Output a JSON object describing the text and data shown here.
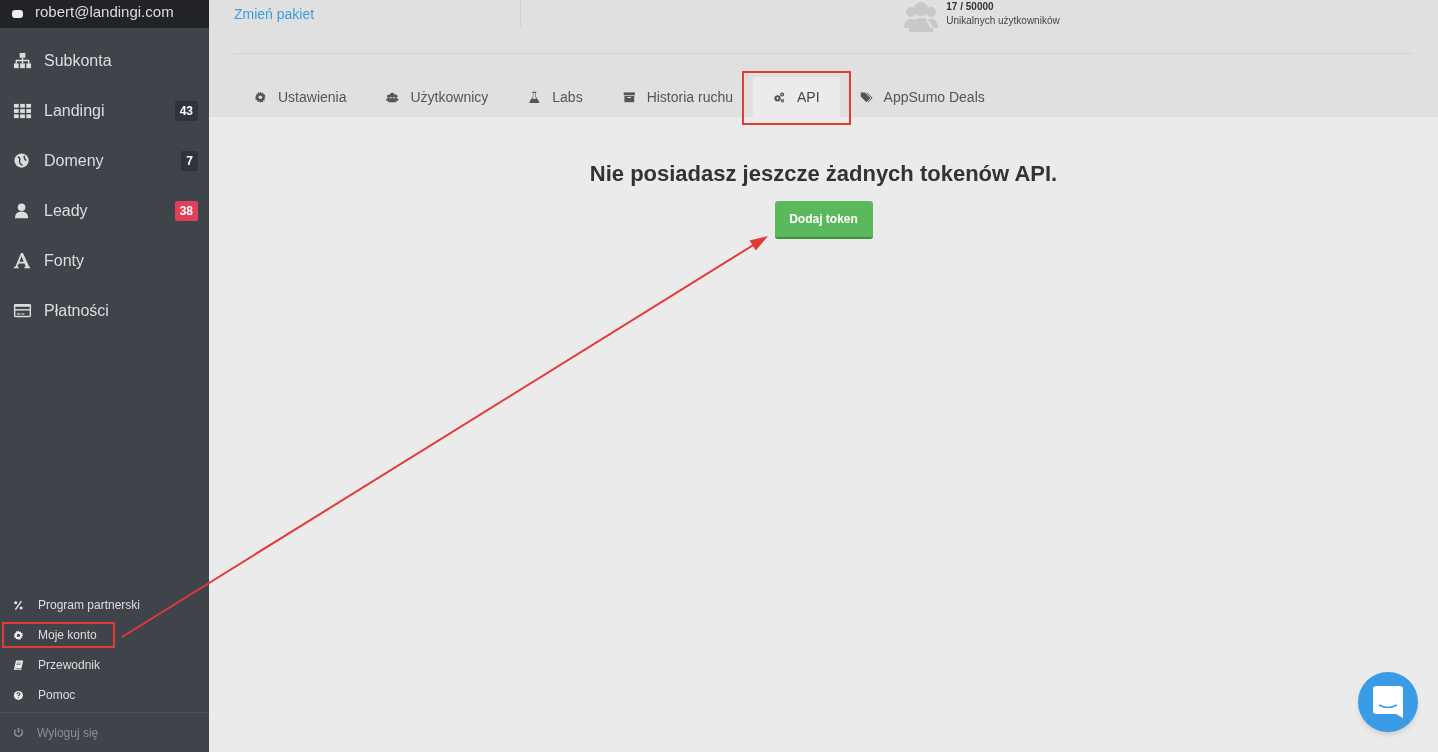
{
  "sidebar": {
    "account_email": "robert@landingi.com",
    "items": [
      {
        "label": "Subkonta"
      },
      {
        "label": "Landingi",
        "badge": "43",
        "color": "#30343a"
      },
      {
        "label": "Domeny",
        "badge": "7",
        "color": "#30343a"
      },
      {
        "label": "Leady",
        "badge": "38",
        "color": "#e0405a"
      },
      {
        "label": "Fonty"
      },
      {
        "label": "Płatności"
      }
    ],
    "footer_items": [
      {
        "label": "Program partnerski",
        "highlighted": false
      },
      {
        "label": "Moje konto",
        "highlighted": true
      },
      {
        "label": "Przewodnik",
        "highlighted": false
      },
      {
        "label": "Pomoc",
        "highlighted": false
      }
    ],
    "logout": {
      "label": "Wyloguj się"
    }
  },
  "header": {
    "change_plan_link": "Zmień pakiet",
    "users_count": "17 / 50000",
    "users_caption": "Unikalnych użytkowników"
  },
  "tabs": [
    {
      "label": "Ustawienia",
      "selected": false,
      "highlighted": false
    },
    {
      "label": "Użytkownicy",
      "selected": false,
      "highlighted": false
    },
    {
      "label": "Labs",
      "selected": false,
      "highlighted": false
    },
    {
      "label": "Historia ruchu",
      "selected": false,
      "highlighted": false
    },
    {
      "label": "API",
      "selected": true,
      "highlighted": true
    },
    {
      "label": "AppSumo Deals",
      "selected": false,
      "highlighted": false
    }
  ],
  "content": {
    "empty_message": "Nie posiadasz jeszcze żadnych tokenów API.",
    "add_button": "Dodaj token"
  }
}
